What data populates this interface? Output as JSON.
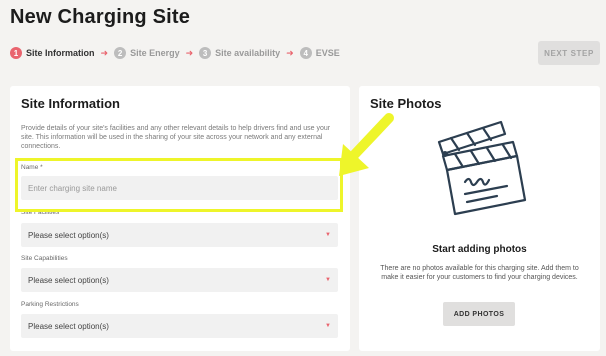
{
  "page": {
    "title": "New Charging Site"
  },
  "stepper": {
    "steps": [
      {
        "num": "1",
        "label": "Site Information"
      },
      {
        "num": "2",
        "label": "Site Energy"
      },
      {
        "num": "3",
        "label": "Site availability"
      },
      {
        "num": "4",
        "label": "EVSE"
      }
    ],
    "next_label": "NEXT STEP"
  },
  "site_info": {
    "heading": "Site Information",
    "description": "Provide details of your site's facilities and any other relevant details to help drivers find and use your site. This information will be used in the sharing of your site across your network and any external connections.",
    "name_label": "Name *",
    "name_placeholder": "Enter charging site name",
    "facilities_label": "Site Facilities",
    "capabilities_label": "Site Capabilities",
    "parking_label": "Parking Restrictions",
    "select_placeholder": "Please select option(s)"
  },
  "site_photos": {
    "heading": "Site Photos",
    "title": "Start adding photos",
    "text": "There are no photos available for this charging site. Add them to make it easier for your customers to find your charging devices.",
    "button": "ADD PHOTOS"
  },
  "colors": {
    "accent": "#e9646e",
    "highlight": "#eef52a"
  }
}
